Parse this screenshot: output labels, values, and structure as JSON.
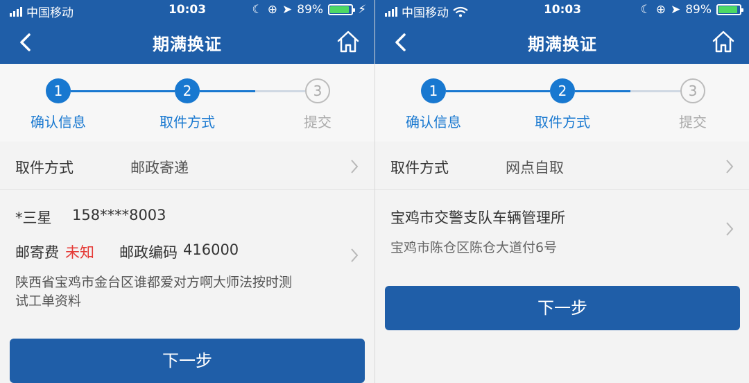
{
  "status": {
    "carrier": "中国移动",
    "time": "10:03",
    "battery": "89%",
    "battery_level": 0.89
  },
  "navbar": {
    "title": "期满换证"
  },
  "steps": [
    {
      "number": "1",
      "label": "确认信息"
    },
    {
      "number": "2",
      "label": "取件方式"
    },
    {
      "number": "3",
      "label": "提交"
    }
  ],
  "left": {
    "pickup_label": "取件方式",
    "pickup_value": "邮政寄递",
    "recipient_name": "*三星",
    "recipient_phone": "158****8003",
    "postage_label": "邮寄费",
    "postage_value": "未知",
    "postcode_label": "邮政编码",
    "postcode_value": "416000",
    "address_line1": "陕西省宝鸡市金台区谁都爱对方啊大师法按时测",
    "address_line2": "试工单资料",
    "next_button": "下一步"
  },
  "right": {
    "pickup_label": "取件方式",
    "pickup_value": "网点自取",
    "office_name": "宝鸡市交警支队车辆管理所",
    "office_address": "宝鸡市陈仓区陈仓大道付6号",
    "next_button": "下一步"
  },
  "colors": {
    "primary": "#1f5ea8",
    "active_step": "#1878d0",
    "warning": "#e53935"
  }
}
